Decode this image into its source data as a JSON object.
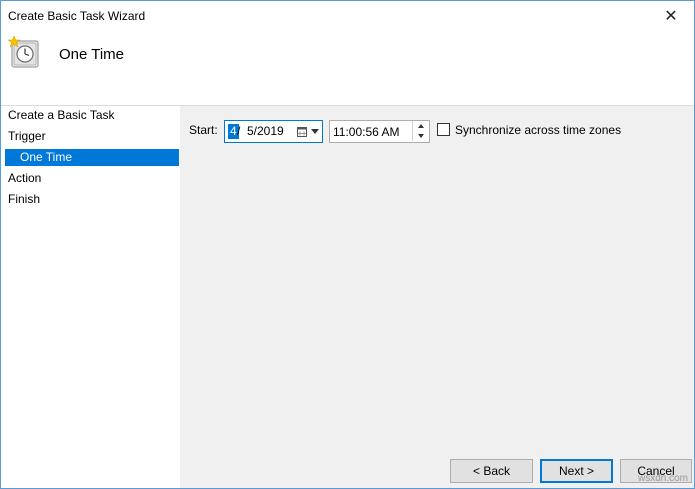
{
  "window": {
    "title": "Create Basic Task Wizard",
    "close_glyph": "✕"
  },
  "header": {
    "title": "One Time",
    "icon": "task-scheduler-clock-icon"
  },
  "sidebar": {
    "steps": [
      {
        "label": "Create a Basic Task"
      },
      {
        "label": "Trigger"
      },
      {
        "label": "One Time",
        "selected": true
      },
      {
        "label": "Action"
      },
      {
        "label": "Finish"
      }
    ]
  },
  "trigger": {
    "start_label": "Start:",
    "date_month": "4",
    "date_rest": "/  5/2019",
    "time": "11:00:56 AM",
    "sync_label": "Synchronize across time zones",
    "sync_checked": false
  },
  "buttons": {
    "back": "< Back",
    "next": "Next >",
    "cancel": "Cancel"
  },
  "watermark": "wsxdn.com",
  "colors": {
    "accent": "#0078d7",
    "selection_text": "#ffffff",
    "background": "#f0f0f0"
  }
}
